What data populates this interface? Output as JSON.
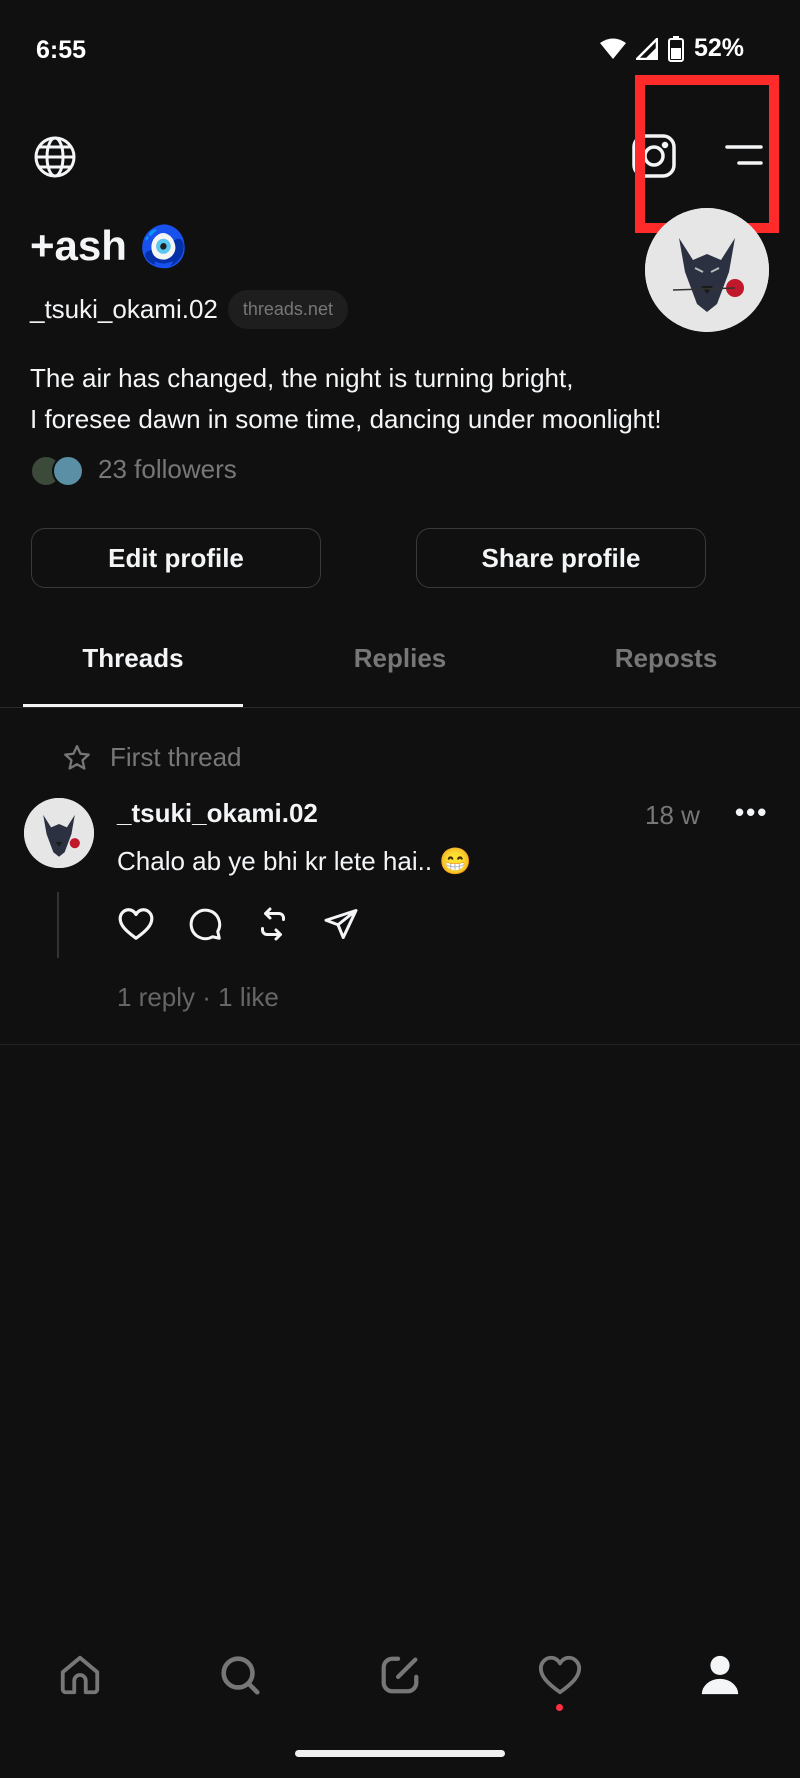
{
  "status_bar": {
    "time": "6:55",
    "battery": "52%"
  },
  "header": {
    "left_icon": "globe-icon",
    "right_icons": [
      "instagram-icon",
      "menu-icon"
    ]
  },
  "profile": {
    "display_name": "+ash",
    "name_emoji": "🧿",
    "username": "_tsuki_okami.02",
    "domain_chip": "threads.net",
    "bio_line1": "The air has changed, the night is turning bright,",
    "bio_line2": "I foresee dawn in some time, dancing under moonlight!",
    "followers": "23 followers"
  },
  "buttons": {
    "edit_profile": "Edit profile",
    "share_profile": "Share profile"
  },
  "tabs": [
    {
      "label": "Threads",
      "active": true
    },
    {
      "label": "Replies",
      "active": false
    },
    {
      "label": "Reposts",
      "active": false
    }
  ],
  "post": {
    "pinned_label": "First thread",
    "username": "_tsuki_okami.02",
    "time": "18 w",
    "more": "•••",
    "text": "Chalo ab ye bhi kr lete hai.. 😁",
    "stats": "1 reply · 1 like"
  },
  "bottom_nav": [
    "home-icon",
    "search-icon",
    "compose-icon",
    "activity-heart-icon",
    "profile-icon"
  ],
  "colors": {
    "background": "#101010",
    "text": "#f3f5f7",
    "muted": "#777777",
    "highlight": "#ff2a2a",
    "notification": "#ff3040"
  }
}
